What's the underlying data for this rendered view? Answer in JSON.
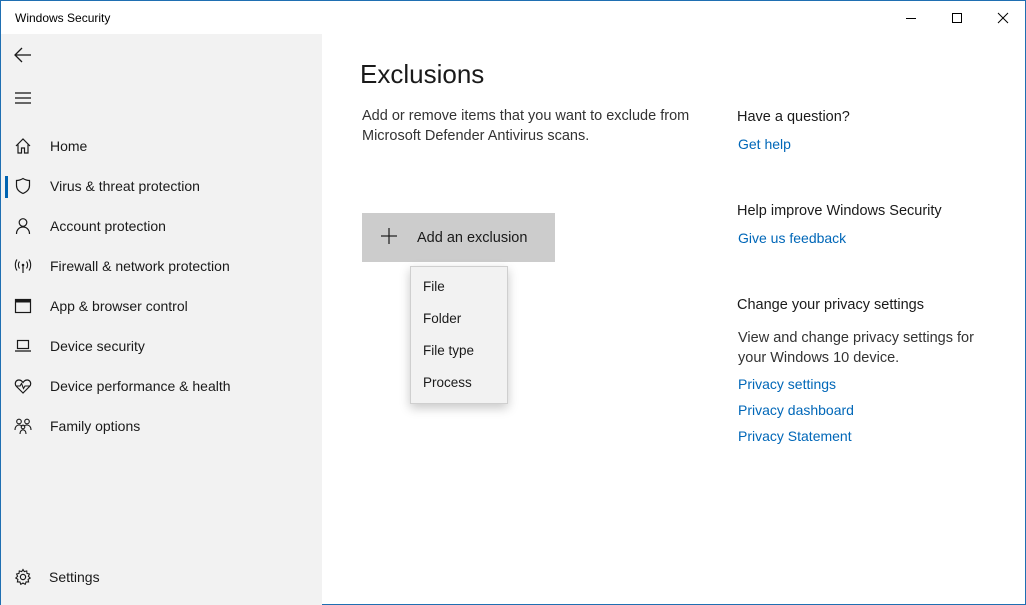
{
  "window": {
    "title": "Windows Security"
  },
  "sidebar": {
    "items": [
      {
        "label": "Home"
      },
      {
        "label": "Virus & threat protection"
      },
      {
        "label": "Account protection"
      },
      {
        "label": "Firewall & network protection"
      },
      {
        "label": "App & browser control"
      },
      {
        "label": "Device security"
      },
      {
        "label": "Device performance & health"
      },
      {
        "label": "Family options"
      }
    ],
    "active_item": "Virus & threat protection",
    "settings_label": "Settings"
  },
  "main": {
    "title": "Exclusions",
    "description": "Add or remove items that you want to exclude from Microsoft Defender Antivirus scans.",
    "add_button_label": "Add an exclusion",
    "dropdown_options": [
      "File",
      "Folder",
      "File type",
      "Process"
    ]
  },
  "aside": {
    "question": {
      "heading": "Have a question?",
      "link": "Get help"
    },
    "improve": {
      "heading": "Help improve Windows Security",
      "link": "Give us feedback"
    },
    "privacy": {
      "heading": "Change your privacy settings",
      "text": "View and change privacy settings for your Windows 10 device.",
      "links": [
        "Privacy settings",
        "Privacy dashboard",
        "Privacy Statement"
      ]
    }
  },
  "colors": {
    "accent": "#0063b1",
    "link": "#0067b8",
    "sidebar_bg": "#f2f2f2",
    "button_bg": "#cccccc"
  },
  "icons": {
    "back": "back-arrow-icon",
    "menu": "hamburger-menu-icon",
    "home": "home-icon",
    "virus": "shield-icon",
    "account": "person-icon",
    "firewall": "antenna-icon",
    "app": "browser-window-icon",
    "device": "laptop-icon",
    "performance": "heart-pulse-icon",
    "family": "family-icon",
    "settings": "gear-icon",
    "add": "plus-icon"
  }
}
